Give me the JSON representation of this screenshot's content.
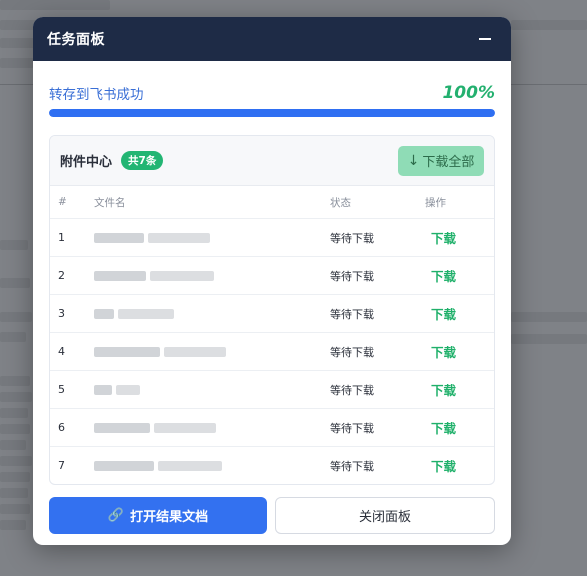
{
  "panel": {
    "title": "任务面板",
    "status_text": "转存到飞书成功",
    "progress_label": "100%",
    "progress_fraction": 1.0
  },
  "attachments": {
    "title": "附件中心",
    "count_badge": "共7条",
    "download_all_icon": "↓",
    "download_all_label": "下载全部",
    "columns": [
      "#",
      "文件名",
      "状态",
      "操作"
    ],
    "rows": [
      {
        "index": "1",
        "status": "等待下载",
        "action": "下载"
      },
      {
        "index": "2",
        "status": "等待下载",
        "action": "下载"
      },
      {
        "index": "3",
        "status": "等待下载",
        "action": "下载"
      },
      {
        "index": "4",
        "status": "等待下载",
        "action": "下载"
      },
      {
        "index": "5",
        "status": "等待下载",
        "action": "下载"
      },
      {
        "index": "6",
        "status": "等待下载",
        "action": "下载"
      },
      {
        "index": "7",
        "status": "等待下载",
        "action": "下载"
      }
    ]
  },
  "footer": {
    "open_icon": "link-icon",
    "open_label": "打开结果文档",
    "close_label": "关闭面板"
  },
  "colors": {
    "header_bg": "#1e2b46",
    "accent_blue": "#2f6ff2",
    "success_green": "#22b573"
  }
}
